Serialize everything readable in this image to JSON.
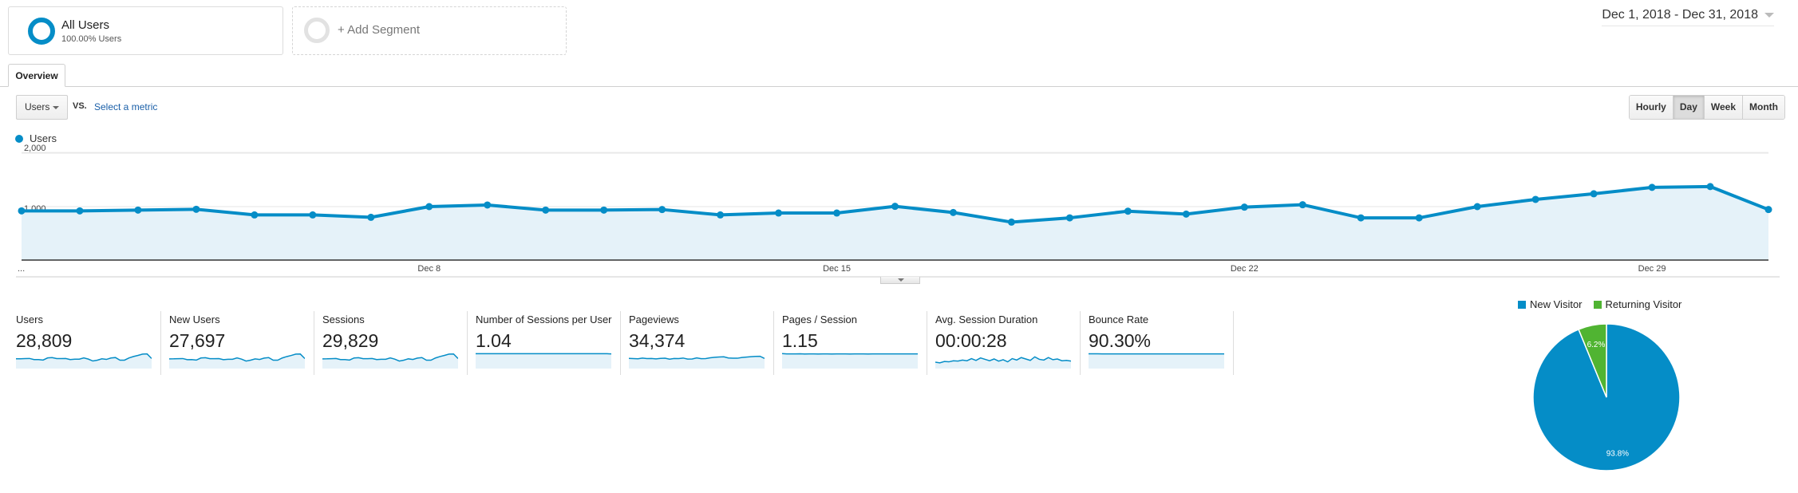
{
  "segments": {
    "active": {
      "title": "All Users",
      "subtitle": "100.00% Users",
      "color": "#058dc7"
    },
    "add_label": "+ Add Segment"
  },
  "date_range": "Dec 1, 2018 - Dec 31, 2018",
  "tabs": [
    {
      "label": "Overview",
      "active": true
    }
  ],
  "metric_selector": {
    "selected": "Users",
    "vs_label": "VS.",
    "secondary_link": "Select a metric"
  },
  "granularity": {
    "options": [
      "Hourly",
      "Day",
      "Week",
      "Month"
    ],
    "selected": "Day"
  },
  "colors": {
    "primary": "#058dc7",
    "area_fill": "#e5f2f9",
    "returning": "#50b432"
  },
  "chart_data": [
    {
      "type": "area",
      "title": "",
      "legend": [
        "Users"
      ],
      "legend_position": "top-left",
      "ylabel": "",
      "xlabel": "",
      "ylim": [
        0,
        2000
      ],
      "yticks": [
        "2,000",
        "1,000"
      ],
      "ytick_values": [
        2000,
        1000
      ],
      "x": [
        "Dec 1",
        "Dec 2",
        "Dec 3",
        "Dec 4",
        "Dec 5",
        "Dec 6",
        "Dec 7",
        "Dec 8",
        "Dec 9",
        "Dec 10",
        "Dec 11",
        "Dec 12",
        "Dec 13",
        "Dec 14",
        "Dec 15",
        "Dec 16",
        "Dec 17",
        "Dec 18",
        "Dec 19",
        "Dec 20",
        "Dec 21",
        "Dec 22",
        "Dec 23",
        "Dec 24",
        "Dec 25",
        "Dec 26",
        "Dec 27",
        "Dec 28",
        "Dec 29",
        "Dec 30",
        "Dec 31"
      ],
      "xtick_labels": [
        {
          "index": 0,
          "label": "..."
        },
        {
          "index": 7,
          "label": "Dec 8"
        },
        {
          "index": 14,
          "label": "Dec 15"
        },
        {
          "index": 21,
          "label": "Dec 22"
        },
        {
          "index": 28,
          "label": "Dec 29"
        }
      ],
      "series": [
        {
          "name": "Users",
          "values": [
            920,
            920,
            935,
            950,
            845,
            845,
            800,
            1000,
            1030,
            935,
            935,
            945,
            845,
            880,
            880,
            1005,
            890,
            710,
            790,
            915,
            860,
            990,
            1035,
            790,
            790,
            1000,
            1135,
            1240,
            1360,
            1375,
            945
          ]
        }
      ],
      "grid": true
    },
    {
      "type": "pie",
      "legend": [
        "New Visitor",
        "Returning Visitor"
      ],
      "legend_position": "top",
      "slices": [
        {
          "label": "New Visitor",
          "value": 93.8,
          "display": "93.8%",
          "color": "#058dc7"
        },
        {
          "label": "Returning Visitor",
          "value": 6.2,
          "display": "6.2%",
          "color": "#50b432"
        }
      ]
    }
  ],
  "scorecards": [
    {
      "label": "Users",
      "value": "28,809",
      "trend": [
        920,
        920,
        935,
        950,
        845,
        845,
        800,
        1000,
        1030,
        935,
        935,
        945,
        845,
        880,
        880,
        1005,
        890,
        710,
        790,
        915,
        860,
        990,
        1035,
        790,
        790,
        1000,
        1135,
        1240,
        1360,
        1375,
        945
      ],
      "trend_min": 0,
      "trend_max": 1500
    },
    {
      "label": "New Users",
      "value": "27,697",
      "trend": [
        880,
        885,
        900,
        910,
        810,
        815,
        770,
        960,
        990,
        900,
        900,
        905,
        810,
        845,
        845,
        965,
        855,
        680,
        760,
        880,
        825,
        950,
        995,
        760,
        760,
        960,
        1090,
        1190,
        1310,
        1320,
        905
      ],
      "trend_min": 0,
      "trend_max": 1450
    },
    {
      "label": "Sessions",
      "value": "29,829",
      "trend": [
        950,
        955,
        970,
        985,
        875,
        875,
        830,
        1035,
        1065,
        970,
        970,
        980,
        875,
        910,
        910,
        1040,
        920,
        735,
        820,
        950,
        890,
        1025,
        1070,
        820,
        820,
        1035,
        1175,
        1285,
        1410,
        1425,
        980
      ],
      "trend_min": 0,
      "trend_max": 1560
    },
    {
      "label": "Number of Sessions per User",
      "value": "1.04",
      "trend": [
        1.04,
        1.04,
        1.04,
        1.04,
        1.04,
        1.04,
        1.04,
        1.04,
        1.04,
        1.04,
        1.04,
        1.04,
        1.04,
        1.04,
        1.04,
        1.04,
        1.04,
        1.04,
        1.04,
        1.04,
        1.04,
        1.04,
        1.04,
        1.04,
        1.04,
        1.04,
        1.04,
        1.04,
        1.04,
        1.04,
        1.03
      ],
      "trend_min": 0,
      "trend_max": 1.12
    },
    {
      "label": "Pageviews",
      "value": "34,374",
      "trend": [
        1080,
        1060,
        1040,
        1120,
        1060,
        1070,
        1030,
        1080,
        1100,
        1000,
        1070,
        1060,
        1120,
        1010,
        1020,
        1140,
        1050,
        1060,
        1150,
        1200,
        1230,
        1250,
        1130,
        1100,
        1100,
        1180,
        1220,
        1260,
        1300,
        1310,
        1080
      ],
      "trend_min": 0,
      "trend_max": 1700
    },
    {
      "label": "Pages / Session",
      "value": "1.15",
      "trend": [
        1.17,
        1.15,
        1.15,
        1.15,
        1.16,
        1.14,
        1.15,
        1.15,
        1.14,
        1.15,
        1.15,
        1.14,
        1.15,
        1.15,
        1.15,
        1.14,
        1.15,
        1.15,
        1.15,
        1.14,
        1.15,
        1.15,
        1.15,
        1.15,
        1.15,
        1.15,
        1.15,
        1.15,
        1.15,
        1.15,
        1.15
      ],
      "trend_min": 0,
      "trend_max": 1.25
    },
    {
      "label": "Avg. Session Duration",
      "value": "00:00:28",
      "trend": [
        18,
        16,
        20,
        19,
        22,
        21,
        24,
        22,
        28,
        23,
        30,
        26,
        22,
        27,
        21,
        25,
        19,
        28,
        24,
        31,
        27,
        23,
        33,
        26,
        24,
        31,
        25,
        27,
        22,
        23,
        21
      ],
      "trend_min": 0,
      "trend_max": 45
    },
    {
      "label": "Bounce Rate",
      "value": "90.30%",
      "trend": [
        90.5,
        90.4,
        90.4,
        90.3,
        90.3,
        90.3,
        90.2,
        90.3,
        90.3,
        90.3,
        90.3,
        90.2,
        90.3,
        90.3,
        90.3,
        90.3,
        90.2,
        90.3,
        90.3,
        90.3,
        90.3,
        90.3,
        90.3,
        90.3,
        90.3,
        90.3,
        90.3,
        90.3,
        90.3,
        90.3,
        90.3
      ],
      "trend_min": 0,
      "trend_max": 98
    }
  ]
}
